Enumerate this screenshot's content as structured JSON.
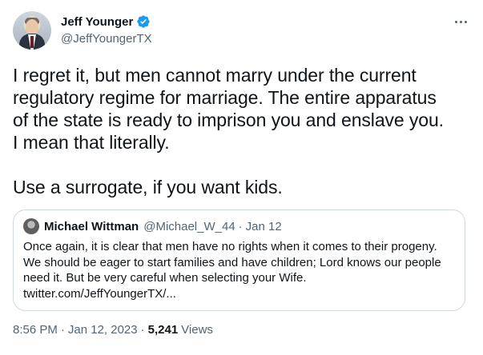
{
  "author": {
    "display_name": "Jeff Younger",
    "handle": "@JeffYoungerTX",
    "verified_color": "#1d9bf0"
  },
  "tweet": {
    "lines": [
      "I regret it, but men cannot marry under the current",
      "regulatory regime for marriage. The entire apparatus",
      "of the state is ready to imprison you and enslave you.",
      "I mean that literally."
    ],
    "second_paragraph": "Use a surrogate, if you want kids."
  },
  "quote": {
    "display_name": "Michael Wittman",
    "handle": "@Michael_W_44",
    "separator": "·",
    "date": "Jan 12",
    "lines": [
      "Once again, it is clear that men have no rights when it comes to their progeny.",
      "We should be eager to start families and have children; Lord knows our people",
      "need it. But be very careful when selecting your Wife.",
      "twitter.com/JeffYoungerTX/..."
    ]
  },
  "meta": {
    "time": "8:56 PM",
    "separator": "·",
    "date": "Jan 12, 2023",
    "views_count": "5,241",
    "views_label": "Views"
  },
  "icons": {
    "more": "more-options-icon",
    "verified": "verified-badge-icon"
  }
}
